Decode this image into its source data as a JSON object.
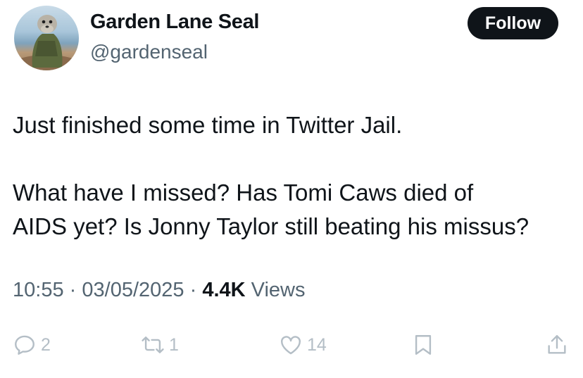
{
  "author": {
    "display_name": "Garden Lane Seal",
    "handle": "@gardenseal"
  },
  "follow_label": "Follow",
  "tweet": {
    "lines": [
      "Just finished some time in Twitter Jail.",
      "What have I missed? Has Tomi Caws died of",
      "AIDS yet? Is Jonny Taylor still beating his missus?"
    ]
  },
  "meta": {
    "time": "10:55",
    "separator": "·",
    "date": "03/05/2025",
    "views_count": "4.4K",
    "views_label": "Views"
  },
  "actions": {
    "replies": "2",
    "reposts": "1",
    "likes": "14"
  },
  "icons": {
    "reply": "reply-icon",
    "repost": "repost-icon",
    "like": "heart-icon",
    "bookmark": "bookmark-icon",
    "share": "share-icon"
  },
  "colors": {
    "text": "#0f1419",
    "secondary": "#536471",
    "action_icons": "#b4bec6",
    "follow_bg": "#0f1419"
  }
}
